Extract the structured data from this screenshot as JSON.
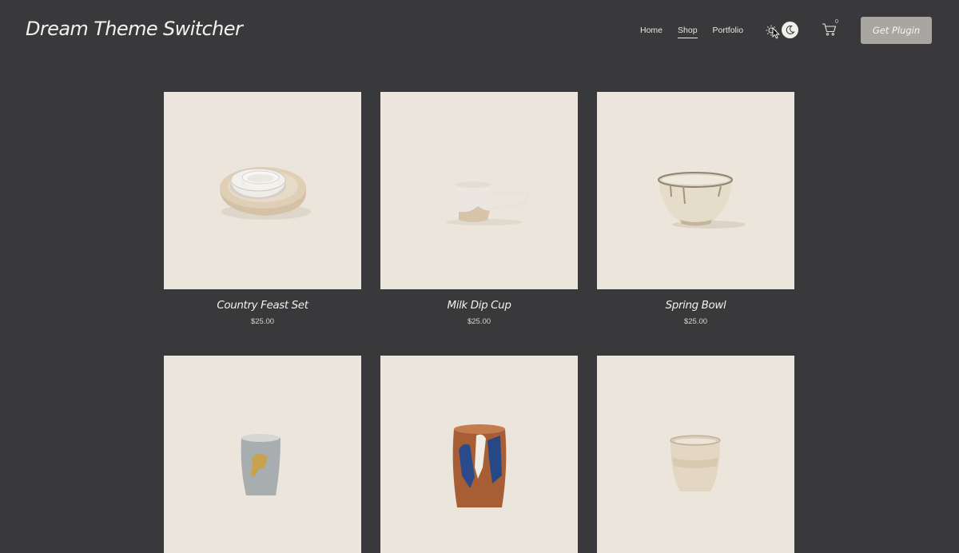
{
  "header": {
    "brand": "Dream Theme Switcher",
    "nav": [
      {
        "label": "Home",
        "active": false
      },
      {
        "label": "Shop",
        "active": true
      },
      {
        "label": "Portfolio",
        "active": false
      }
    ],
    "cart_count": "0",
    "cta_label": "Get Plugin"
  },
  "products": [
    {
      "name": "Country Feast Set",
      "price": "$25.00",
      "icon": "nested-bowls-image"
    },
    {
      "name": "Milk Dip Cup",
      "price": "$25.00",
      "icon": "cup-image"
    },
    {
      "name": "Spring Bowl",
      "price": "$25.00",
      "icon": "bowl-image"
    },
    {
      "icon": "painted-tumbler-image"
    },
    {
      "icon": "blue-brown-vase-image"
    },
    {
      "icon": "small-cup-image"
    }
  ],
  "colors": {
    "background": "#39383a",
    "tile": "#ece5db",
    "button": "#a9a6a2"
  }
}
